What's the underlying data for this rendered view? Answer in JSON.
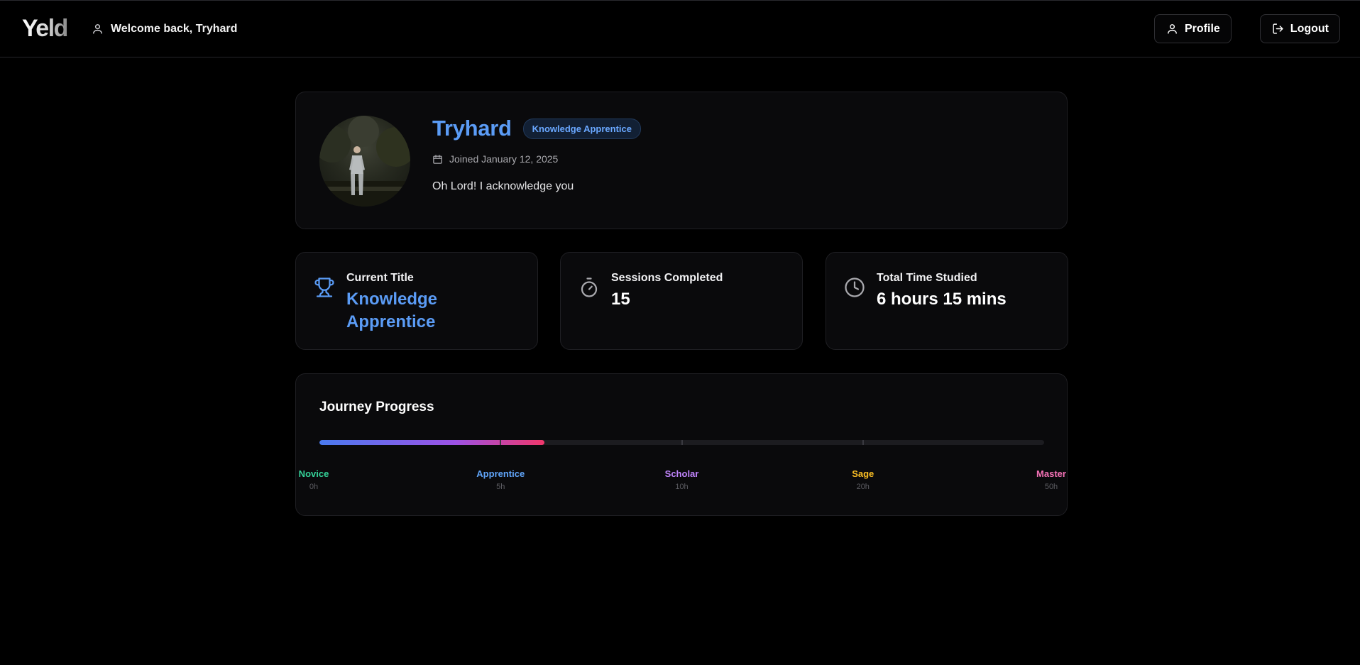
{
  "header": {
    "logo": "Yeld",
    "welcome": "Welcome back, Tryhard",
    "profile_label": "Profile",
    "logout_label": "Logout"
  },
  "profile": {
    "name": "Tryhard",
    "badge": "Knowledge Apprentice",
    "joined": "Joined January 12, 2025",
    "bio": "Oh Lord! I acknowledge you"
  },
  "stats": [
    {
      "label": "Current Title",
      "value": "Knowledge Apprentice",
      "icon": "trophy-icon",
      "color": "#5b9cf6"
    },
    {
      "label": "Sessions Completed",
      "value": "15",
      "icon": "timer-icon"
    },
    {
      "label": "Total Time Studied",
      "value": "6 hours 15 mins",
      "icon": "clock-icon"
    }
  ],
  "journey": {
    "title": "Journey Progress",
    "progress_fraction": 0.31,
    "milestones": [
      {
        "name": "Novice",
        "hours": "0h",
        "color": "#34d399"
      },
      {
        "name": "Apprentice",
        "hours": "5h",
        "color": "#60a5fa"
      },
      {
        "name": "Scholar",
        "hours": "10h",
        "color": "#c084fc"
      },
      {
        "name": "Sage",
        "hours": "20h",
        "color": "#fbbf24"
      },
      {
        "name": "Master",
        "hours": "50h",
        "color": "#f472b6"
      }
    ]
  }
}
